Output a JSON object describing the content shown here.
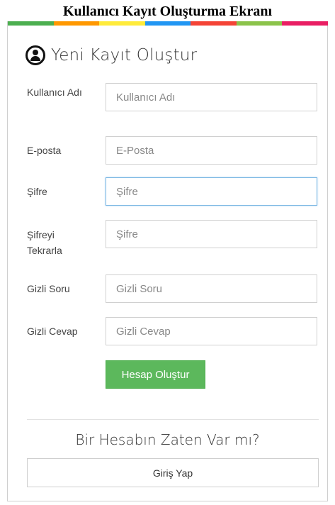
{
  "page_title": "Kullanıcı Kayıt Oluşturma Ekranı",
  "color_bar": [
    "#4caf50",
    "#ff9800",
    "#ffeb3b",
    "#2196f3",
    "#f44336",
    "#8bc34a",
    "#e91e63"
  ],
  "form": {
    "title": "Yeni Kayıt Oluştur",
    "icon": "user-circle-icon",
    "fields": [
      {
        "label": "Kullanıcı Adı",
        "placeholder": "Kullanıcı Adı"
      },
      {
        "label": "E-posta",
        "placeholder": "E-Posta"
      },
      {
        "label": "Şifre",
        "placeholder": "Şifre"
      },
      {
        "label": "Şifreyi Tekrarla",
        "placeholder": "Şifre"
      },
      {
        "label": "Gizli Soru",
        "placeholder": "Gizli Soru"
      },
      {
        "label": "Gizli Cevap",
        "placeholder": "Gizli Cevap"
      }
    ],
    "submit_label": "Hesap Oluştur"
  },
  "login": {
    "prompt": "Bir Hesabın Zaten Var mı?",
    "button_label": "Giriş Yap"
  },
  "colors": {
    "submit": "#5cb85c",
    "focus_border": "#7ab6e3"
  }
}
